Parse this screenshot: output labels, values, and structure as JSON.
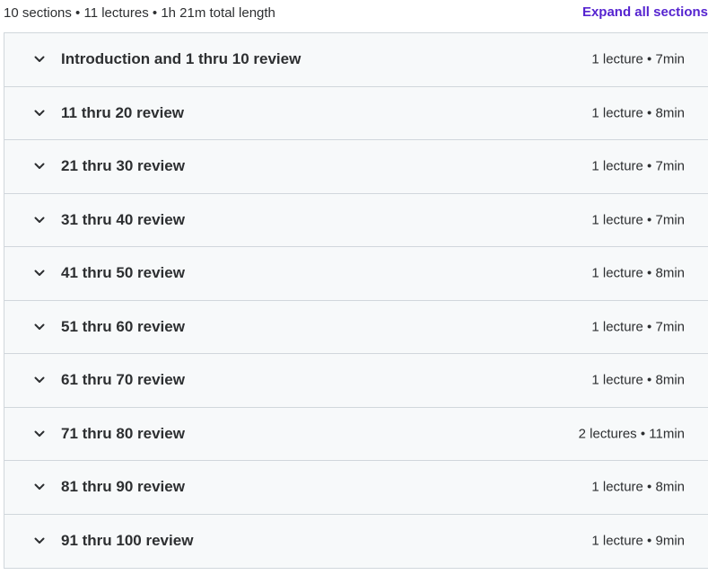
{
  "summary": {
    "text": "10 sections • 11 lectures • 1h 21m total length",
    "expand_label": "Expand all sections"
  },
  "colors": {
    "link": "#5624d0",
    "row_background": "#f7f9fa",
    "border": "#d1d7dc",
    "text": "#2d2f31"
  },
  "sections": [
    {
      "title": "Introduction and 1 thru 10 review",
      "meta": "1 lecture • 7min",
      "icon": "chevron-down-icon"
    },
    {
      "title": "11 thru 20 review",
      "meta": "1 lecture • 8min",
      "icon": "chevron-down-icon"
    },
    {
      "title": "21 thru 30 review",
      "meta": "1 lecture • 7min",
      "icon": "chevron-down-icon"
    },
    {
      "title": "31 thru 40 review",
      "meta": "1 lecture • 7min",
      "icon": "chevron-down-icon"
    },
    {
      "title": "41 thru 50 review",
      "meta": "1 lecture • 8min",
      "icon": "chevron-down-icon"
    },
    {
      "title": "51 thru 60 review",
      "meta": "1 lecture • 7min",
      "icon": "chevron-down-icon"
    },
    {
      "title": "61 thru 70 review",
      "meta": "1 lecture • 8min",
      "icon": "chevron-down-icon"
    },
    {
      "title": "71 thru 80 review",
      "meta": "2 lectures • 11min",
      "icon": "chevron-down-icon"
    },
    {
      "title": "81 thru 90 review",
      "meta": "1 lecture • 8min",
      "icon": "chevron-down-icon"
    },
    {
      "title": "91 thru 100 review",
      "meta": "1 lecture • 9min",
      "icon": "chevron-down-icon"
    }
  ]
}
